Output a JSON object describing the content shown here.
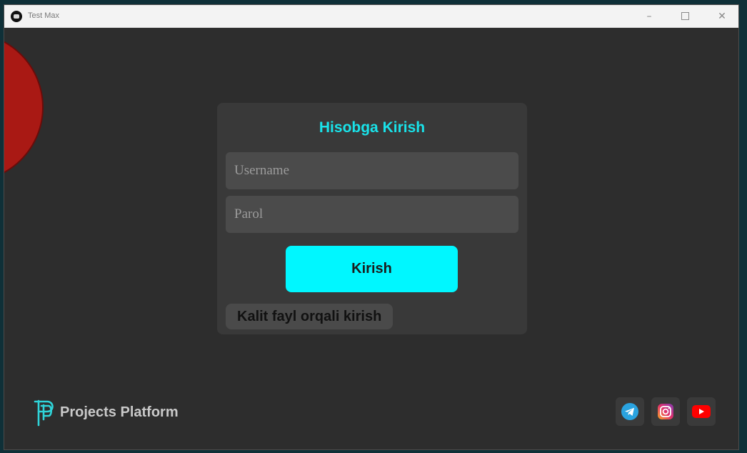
{
  "window": {
    "title": "Test Max",
    "controls": {
      "minimize": "–",
      "close": "✕"
    }
  },
  "login": {
    "title": "Hisobga Kirish",
    "username_placeholder": "Username",
    "password_placeholder": "Parol",
    "submit_label": "Kirish",
    "keyfile_label": "Kalit fayl orqali kirish"
  },
  "brand": {
    "name": "Projects Platform"
  },
  "social": [
    {
      "icon": "telegram-icon",
      "color": "#2aa3e0"
    },
    {
      "icon": "instagram-icon",
      "color": "#e1306c"
    },
    {
      "icon": "youtube-icon",
      "color": "#ff0000"
    }
  ],
  "colors": {
    "accent": "#00f7ff",
    "title_accent": "#19e3ea",
    "window_bg": "#2d2d2d",
    "card_bg": "#393939",
    "decor_red": "#a91914"
  }
}
